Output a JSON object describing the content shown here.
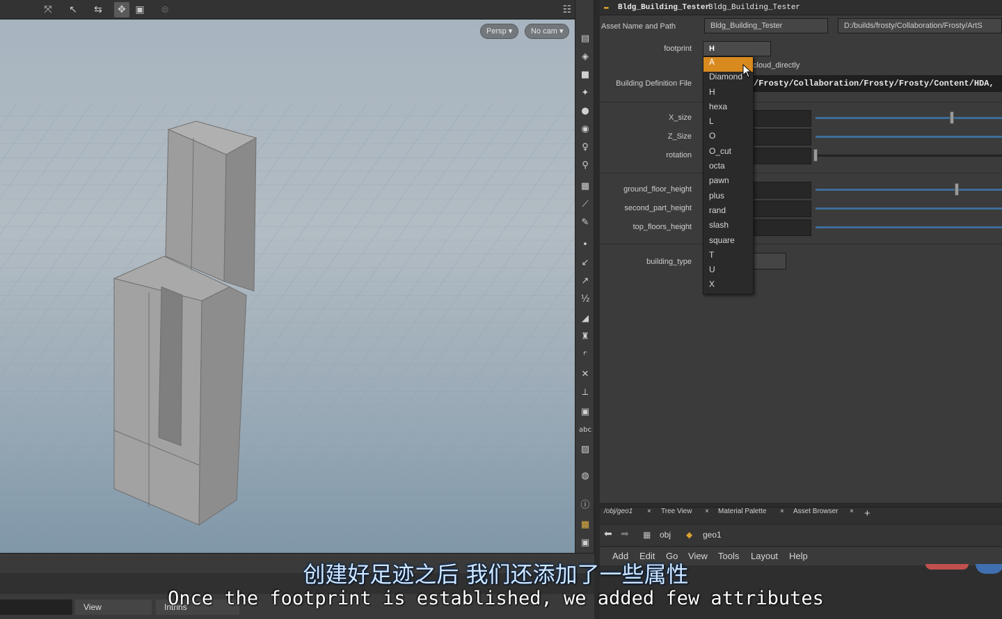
{
  "viewport": {
    "camera_persp": "Persp ▾",
    "camera_nocam": "No cam ▾",
    "bottom_view": "View",
    "bottom_intrinsics": "Intrins"
  },
  "params": {
    "title_node": "Bldg_Building_Tester",
    "title_name": "Bldg_Building_Tester",
    "asset_label": "Asset Name and Path",
    "asset_name": "Bldg_Building_Tester",
    "asset_path": "D:/builds/frosty/Collaboration/Frosty/ArtS",
    "footprint_label": "footprint",
    "footprint_value": "H",
    "cloud_text": "cloud_directly",
    "bdf_label": "Building Definition File",
    "bdf_value": "/Frosty/Collaboration/Frosty/Frosty/Content/HDA,",
    "xsize_label": "X_size",
    "zsize_label": "Z_Size",
    "rotation_label": "rotation",
    "ground_label": "ground_floor_height",
    "second_label": "second_part_height",
    "top_label": "top_floors_height",
    "btype_label": "building_type"
  },
  "dropdown": {
    "options": [
      "A",
      "Diamond",
      "H",
      "hexa",
      "L",
      "O",
      "O_cut",
      "octa",
      "pawn",
      "plus",
      "rand",
      "slash",
      "square",
      "T",
      "U",
      "X"
    ]
  },
  "network": {
    "tab_path": "/obj/geo1",
    "tab_tree": "Tree View",
    "tab_material": "Material Palette",
    "tab_asset": "Asset Browser",
    "add_tab": "+",
    "path_obj": "obj",
    "path_geo": "geo1",
    "menu": [
      "Add",
      "Edit",
      "Go",
      "View",
      "Tools",
      "Layout",
      "Help"
    ]
  },
  "subtitles": {
    "cn": "创建好足迹之后 我们还添加了一些属性",
    "en": "Once the footprint is established, we added few attributes"
  },
  "colors": {
    "accent": "#d98a1f",
    "slider": "#3d6d9a"
  }
}
